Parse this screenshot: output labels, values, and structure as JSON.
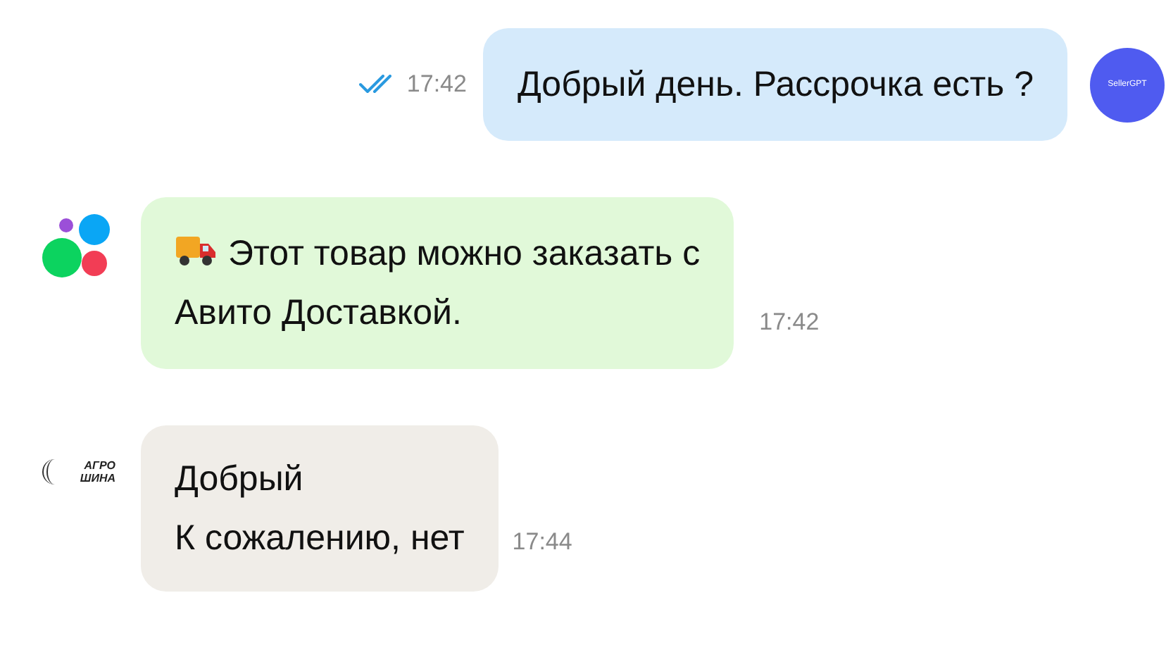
{
  "messages": [
    {
      "kind": "outgoing",
      "sender": "SellerGPT",
      "read": true,
      "time": "17:42",
      "lines": [
        "Добрый день. Рассрочка есть ?"
      ]
    },
    {
      "kind": "system",
      "time": "17:42",
      "lines": [
        "Этот товар можно заказать с",
        "Авито Доставкой."
      ]
    },
    {
      "kind": "incoming",
      "sender_logo": [
        "АГРО",
        "ШИНА"
      ],
      "time": "17:44",
      "lines": [
        "Добрый",
        "К сожалению, нет"
      ]
    }
  ]
}
